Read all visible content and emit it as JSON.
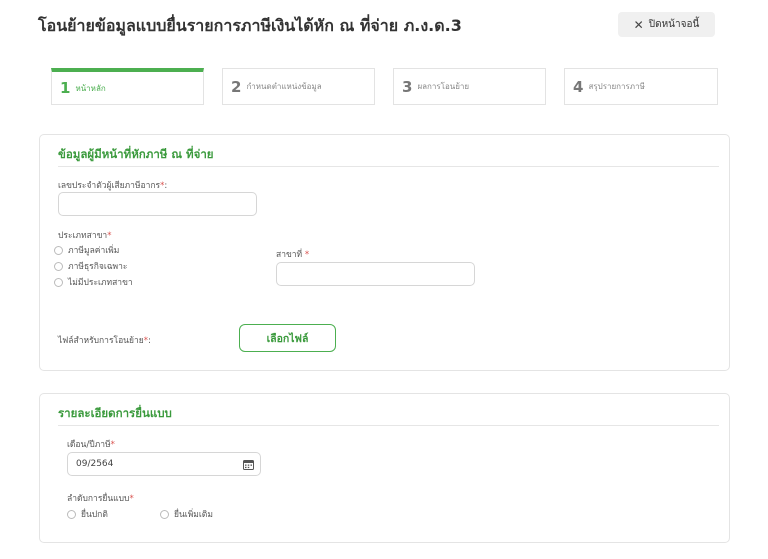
{
  "header": {
    "title": "โอนย้ายข้อมูลแบบยื่นรายการภาษีเงินได้หัก ณ ที่จ่าย ภ.ง.ด.3",
    "close_label": "ปิดหน้าจอนี้"
  },
  "steps": [
    {
      "num": "1",
      "label": "หน้าหลัก",
      "active": true
    },
    {
      "num": "2",
      "label": "กำหนดตำแหน่งข้อมูล",
      "active": false
    },
    {
      "num": "3",
      "label": "ผลการโอนย้าย",
      "active": false
    },
    {
      "num": "4",
      "label": "สรุปรายการภาษี",
      "active": false
    }
  ],
  "payer_section": {
    "title": "ข้อมูลผู้มีหน้าที่หักภาษี ณ ที่จ่าย",
    "tax_id_label": "เลขประจำตัวผู้เสียภาษีอากร",
    "tax_id_value": "",
    "branch_type_label": "ประเภทสาขา",
    "branch_type_options": [
      "ภาษีมูลค่าเพิ่ม",
      "ภาษีธุรกิจเฉพาะ",
      "ไม่มีประเภทสาขา"
    ],
    "branch_no_label": "สาขาที่ ",
    "branch_no_value": "",
    "file_label": "ไฟล์สำหรับการโอนย้าย",
    "file_button": "เลือกไฟล์",
    "required_mark": "*"
  },
  "filing_section": {
    "title": "รายละเอียดการยื่นแบบ",
    "period_label": "เดือน/ปีภาษี",
    "period_value": "09/2564",
    "sequence_label": "ลำดับการยื่นแบบ",
    "sequence_options": [
      "ยื่นปกติ",
      "ยื่นเพิ่มเติม"
    ],
    "required_mark": "*"
  },
  "colors": {
    "accent": "#4caf50",
    "accent_text": "#3a9a3c",
    "required": "#d9534f"
  },
  "icons": {
    "close": "close-icon",
    "calendar": "calendar-icon"
  }
}
